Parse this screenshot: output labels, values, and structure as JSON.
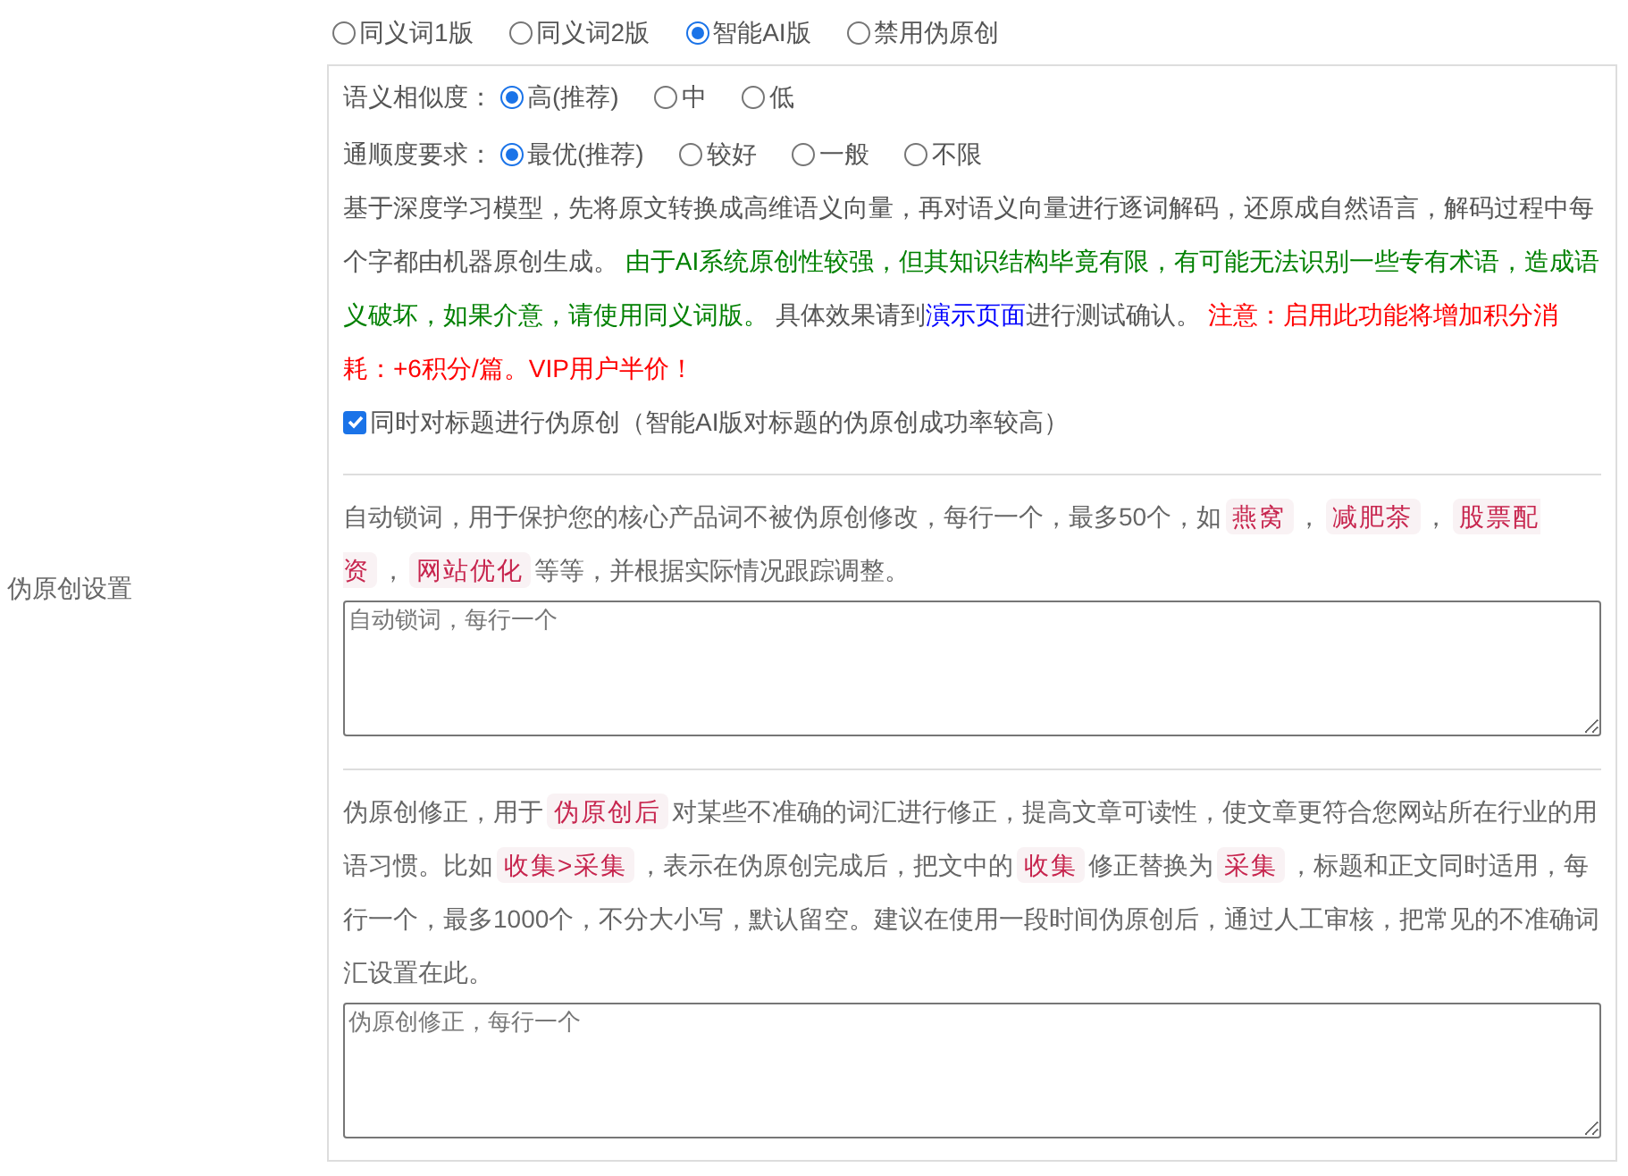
{
  "section_label": "伪原创设置",
  "modes": [
    {
      "label": "同义词1版",
      "selected": false
    },
    {
      "label": "同义词2版",
      "selected": false
    },
    {
      "label": "智能AI版",
      "selected": true
    },
    {
      "label": "禁用伪原创",
      "selected": false
    }
  ],
  "similarity": {
    "label": "语义相似度：",
    "options": [
      {
        "label": "高(推荐)",
        "selected": true
      },
      {
        "label": "中",
        "selected": false
      },
      {
        "label": "低",
        "selected": false
      }
    ]
  },
  "fluency": {
    "label": "通顺度要求：",
    "options": [
      {
        "label": "最优(推荐)",
        "selected": true
      },
      {
        "label": "较好",
        "selected": false
      },
      {
        "label": "一般",
        "selected": false
      },
      {
        "label": "不限",
        "selected": false
      }
    ]
  },
  "ai_description": [
    {
      "kind": "plain",
      "text": "基于深度学习模型，先将原文转换成高维语义向量，再对语义向量进行逐词解码，还原成自然语言，解码过程中每个字都由机器原创生成。 "
    },
    {
      "kind": "note",
      "text": "由于AI系统原创性较强，但其知识结构毕竟有限，有可能无法识别一些专有术语，造成语义破坏，如果介意，请使用同义词版。"
    },
    {
      "kind": "plain",
      "text": " 具体效果请到"
    },
    {
      "kind": "link",
      "text": "演示页面"
    },
    {
      "kind": "plain",
      "text": "进行测试确认。 "
    },
    {
      "kind": "warning",
      "text": "注意：启用此功能将增加积分消耗：+6积分/篇。VIP用户半价！"
    }
  ],
  "title_option": {
    "label": "同时对标题进行伪原创（智能AI版对标题的伪原创成功率较高）",
    "checked": true
  },
  "lock_words": {
    "description": [
      {
        "kind": "text",
        "text": "自动锁词，用于保护您的核心产品词不被伪原创修改，每行一个，最多50个，如"
      },
      {
        "kind": "code",
        "text": "燕窝"
      },
      {
        "kind": "text",
        "text": "，"
      },
      {
        "kind": "code",
        "text": "减肥茶"
      },
      {
        "kind": "text",
        "text": "，"
      },
      {
        "kind": "code",
        "text": "股票配资"
      },
      {
        "kind": "text",
        "text": "，"
      },
      {
        "kind": "code",
        "text": "网站优化"
      },
      {
        "kind": "text",
        "text": "等等，并根据实际情况跟踪调整。"
      }
    ],
    "placeholder": "自动锁词，每行一个"
  },
  "corrections": {
    "description": [
      {
        "kind": "text",
        "text": "伪原创修正，用于"
      },
      {
        "kind": "code",
        "text": "伪原创后"
      },
      {
        "kind": "text",
        "text": "对某些不准确的词汇进行修正，提高文章可读性，使文章更符合您网站所在行业的用语习惯。比如"
      },
      {
        "kind": "code",
        "text": "收集>采集"
      },
      {
        "kind": "text",
        "text": "，表示在伪原创完成后，把文中的"
      },
      {
        "kind": "code",
        "text": "收集"
      },
      {
        "kind": "text",
        "text": "修正替换为"
      },
      {
        "kind": "code",
        "text": "采集"
      },
      {
        "kind": "text",
        "text": "，标题和正文同时适用，每行一个，最多1000个，不分大小写，默认留空。建议在使用一段时间伪原创后，通过人工审核，把常见的不准确词汇设置在此。"
      }
    ],
    "placeholder": "伪原创修正，每行一个"
  }
}
